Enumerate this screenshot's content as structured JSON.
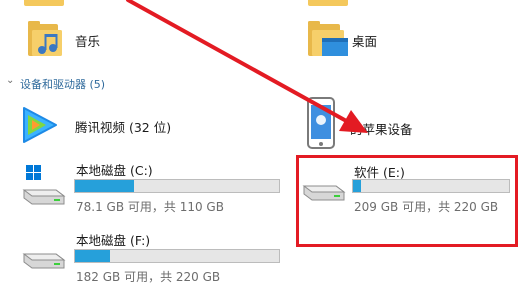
{
  "folders": {
    "music_label": "音乐",
    "desktop_label": "桌面"
  },
  "section": {
    "devices_header": "设备和驱动器 (5)"
  },
  "devices": {
    "tencent_label": "腾讯视频 (32 位)",
    "apple_label": "的苹果设备"
  },
  "drives": [
    {
      "name": "本地磁盘 (C:)",
      "info": "78.1 GB 可用，共 110 GB",
      "used_fraction": 0.29
    },
    {
      "name": "软件 (E:)",
      "info": "209 GB 可用，共 220 GB",
      "used_fraction": 0.05
    },
    {
      "name": "本地磁盘 (F:)",
      "info": "182 GB 可用，共 220 GB",
      "used_fraction": 0.17
    }
  ],
  "colors": {
    "bar_fill": "#26a0da",
    "annotation_red": "#e31b23",
    "section_header": "#2f6a9c"
  }
}
